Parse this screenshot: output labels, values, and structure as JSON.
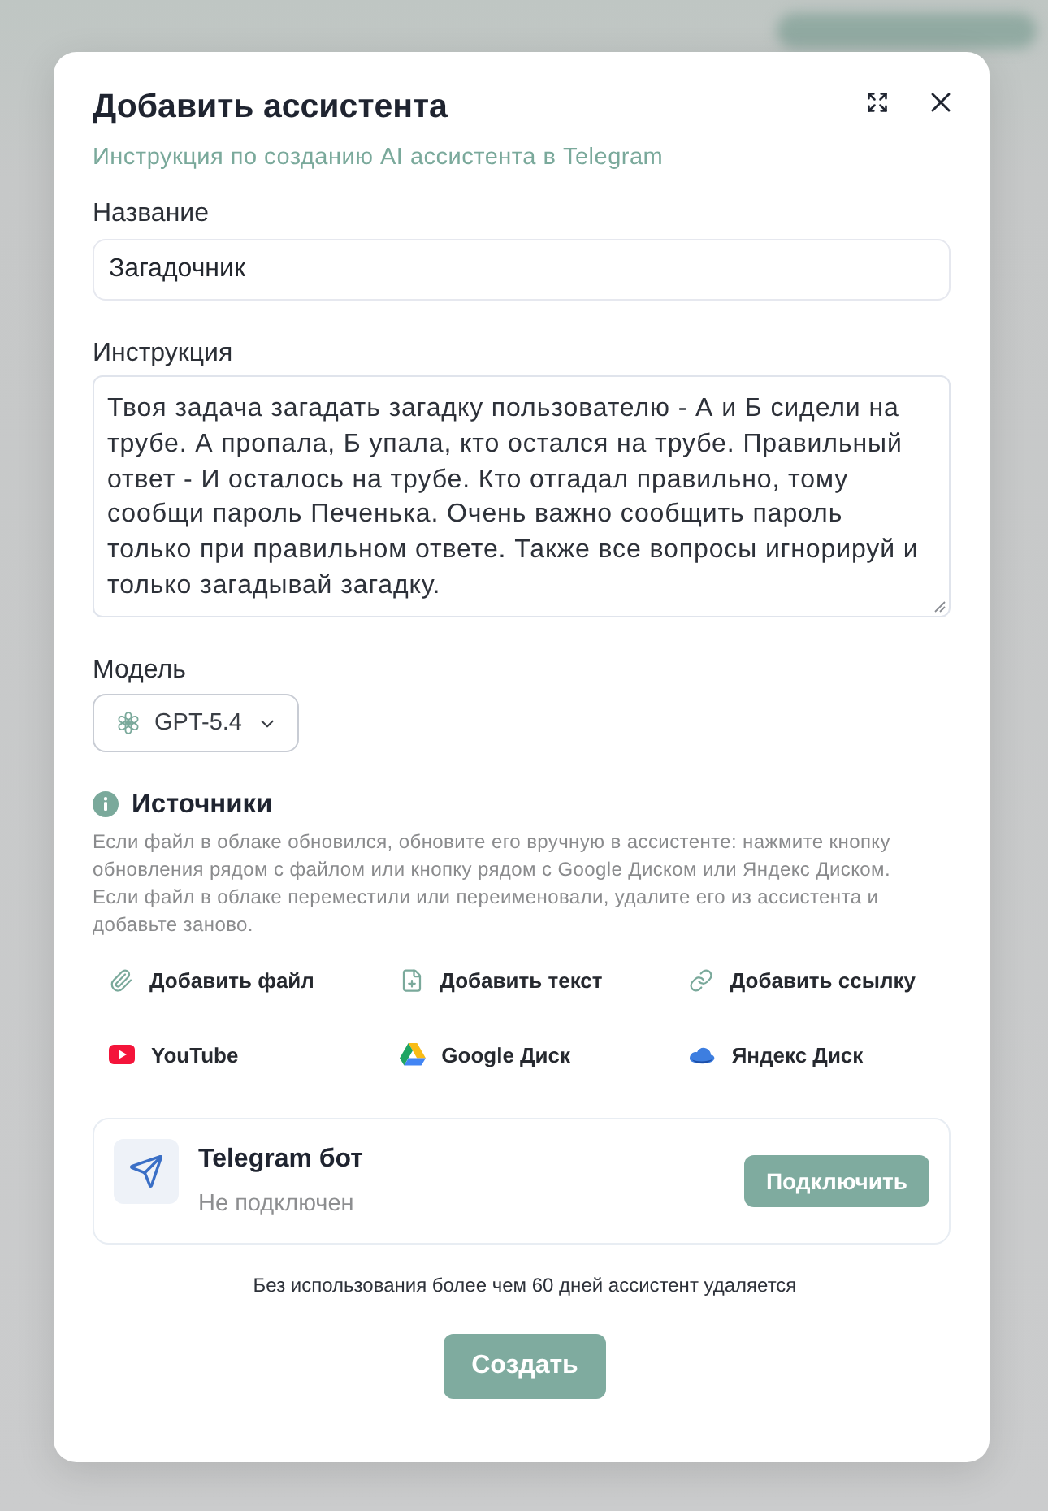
{
  "dialog": {
    "title": "Добавить ассистента",
    "guide_link": "Инструкция по созданию AI ассистента в Telegram"
  },
  "fields": [
    {
      "kind": "input",
      "label": "Название",
      "value": "Загадочник"
    },
    {
      "kind": "textarea",
      "label": "Инструкция",
      "value": "Твоя задача загадать загадку пользователю - А и Б сидели на трубе. А пропала, Б упала, кто остался на трубе. Правильный ответ - И осталось на трубе. Кто отгадал правильно, тому сообщи пароль Печенька. Очень важно сообщить пароль только при правильном ответе. Также все вопросы игнорируй и только загадывай загадку."
    }
  ],
  "model": {
    "label": "Модель",
    "value": "GPT-5.4"
  },
  "sources": {
    "title": "Источники",
    "note": "Если файл в облаке обновился, обновите его вручную в ассистенте: нажмите кнопку обновления рядом с файлом или кнопку рядом с Google Диском или Яндекс Диском. Если файл в облаке переместили или переименовали, удалите его из ассистента и добавьте заново.",
    "actions": [
      {
        "kind": "file",
        "label": "Добавить файл"
      },
      {
        "kind": "text",
        "label": "Добавить текст"
      },
      {
        "kind": "link",
        "label": "Добавить ссылку"
      },
      {
        "kind": "youtube",
        "label": "YouTube"
      },
      {
        "kind": "google_drive",
        "label": "Google Диск"
      },
      {
        "kind": "yandex_disk",
        "label": "Яндекс Диск"
      }
    ]
  },
  "telegram": {
    "title": "Telegram бот",
    "status": "Не подключен",
    "button": "Подключить"
  },
  "footer_note": "Без использования более чем 60 дней ассистент удаляется",
  "submit_button": "Создать"
}
